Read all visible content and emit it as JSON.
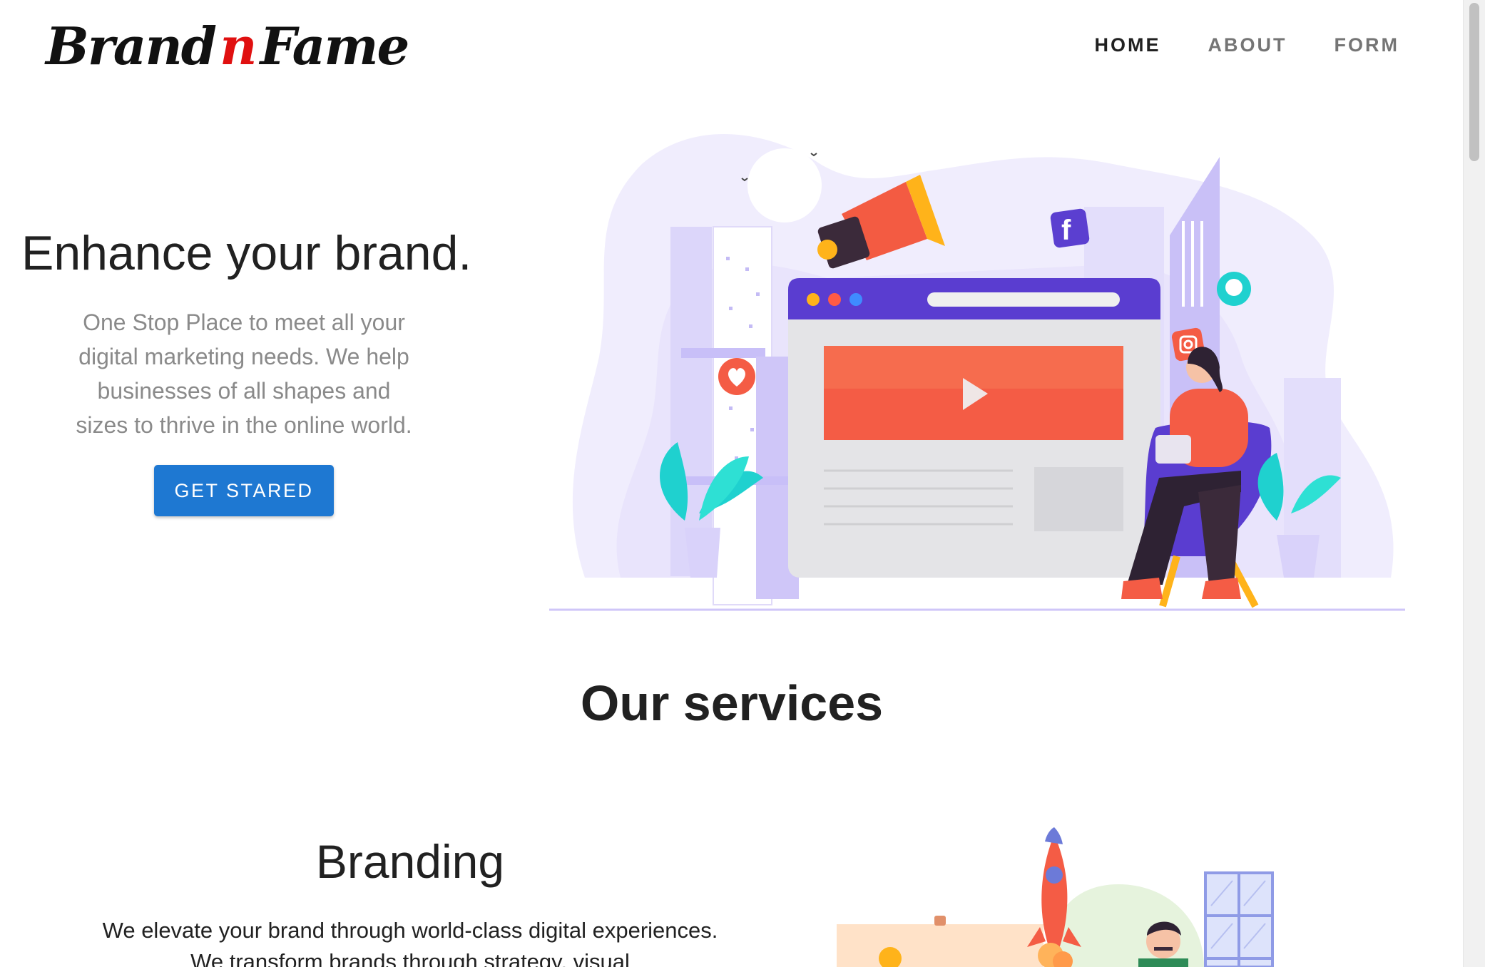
{
  "header": {
    "logo": {
      "part1": "Brand",
      "part2": "n",
      "part3": "Fame"
    },
    "nav": [
      {
        "label": "HOME",
        "active": true
      },
      {
        "label": "ABOUT",
        "active": false
      },
      {
        "label": "FORM",
        "active": false
      }
    ]
  },
  "hero": {
    "title": "Enhance your brand.",
    "subtitle": "One Stop Place to meet all your digital marketing needs. We help businesses of all shapes and sizes to thrive in the online world.",
    "cta_label": "GET STARED"
  },
  "services": {
    "title": "Our services",
    "items": [
      {
        "title": "Branding",
        "text": "We elevate your brand through world-class digital experiences. We transform brands through strategy, visual"
      }
    ]
  },
  "colors": {
    "accent": "#1e78d2",
    "logo_n": "#e01010",
    "illustration_purple": "#5b3fd0",
    "illustration_red": "#f5543f"
  },
  "icons": [
    "facebook-icon",
    "instagram-icon",
    "heart-icon",
    "chat-icon",
    "play-icon",
    "megaphone-icon",
    "rocket-icon"
  ]
}
